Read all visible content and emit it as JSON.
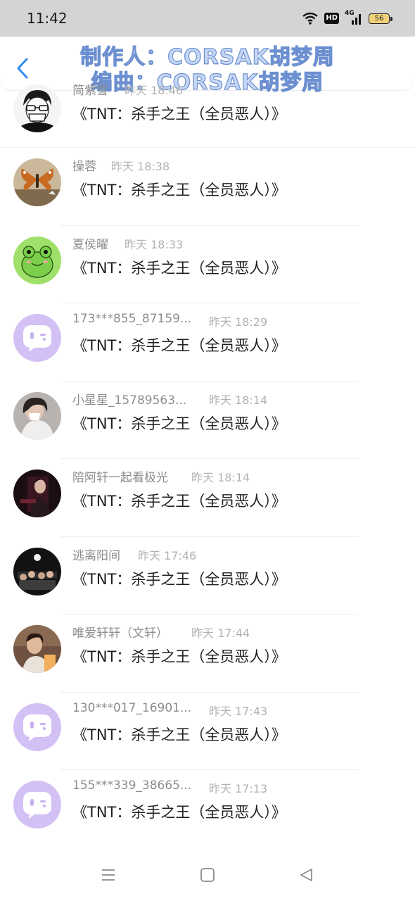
{
  "status_bar": {
    "time": "11:42",
    "hd_label": "HD",
    "network_label": "4G",
    "battery_level": "56"
  },
  "header": {
    "back_icon": "chevron-left-icon",
    "overlay_line1": "制作人：CORSAK胡梦周",
    "overlay_line2": "编曲：CORSAK胡梦周"
  },
  "comments": [
    {
      "name": "简紫雪",
      "time": "昨天 18:46",
      "message": "《TNT：杀手之王（全员恶人）》",
      "avatar": "sketch-boy-avatar"
    },
    {
      "name": "操蓉",
      "time": "昨天 18:38",
      "message": "《TNT：杀手之王（全员恶人）》",
      "avatar": "butterfly-avatar"
    },
    {
      "name": "夏侯曜",
      "time": "昨天 18:33",
      "message": "《TNT：杀手之王（全员恶人）》",
      "avatar": "frog-avatar"
    },
    {
      "name": "173***855_87159...",
      "time": "昨天 18:29",
      "message": "《TNT：杀手之王（全员恶人）》",
      "avatar": "default-chat-avatar"
    },
    {
      "name": "小星星_15789563...",
      "time": "昨天 18:14",
      "message": "《TNT：杀手之王（全员恶人）》",
      "avatar": "photo-avatar"
    },
    {
      "name": "陪阿轩一起看极光",
      "time": "昨天 18:14",
      "message": "《TNT：杀手之王（全员恶人）》",
      "avatar": "photo-avatar"
    },
    {
      "name": "逃离阳间",
      "time": "昨天 17:46",
      "message": "《TNT：杀手之王（全员恶人）》",
      "avatar": "photo-avatar"
    },
    {
      "name": "唯爱轩轩（文轩）",
      "time": "昨天 17:44",
      "message": "《TNT：杀手之王（全员恶人）》",
      "avatar": "photo-avatar"
    },
    {
      "name": "130***017_16901...",
      "time": "昨天 17:43",
      "message": "《TNT：杀手之王（全员恶人）》",
      "avatar": "default-chat-avatar"
    },
    {
      "name": "155***339_38665...",
      "time": "昨天 17:13",
      "message": "《TNT：杀手之王（全员恶人）》",
      "avatar": "default-chat-avatar"
    }
  ],
  "nav_bar": {
    "menu_icon": "menu-icon",
    "home_icon": "home-square-icon",
    "back_icon": "back-triangle-icon"
  },
  "colors": {
    "overlay_fill": "#c6d7f4",
    "overlay_stroke": "#6b8fd0",
    "back_arrow": "#2b8cf0",
    "default_avatar_bg": "#cdb8f2"
  }
}
